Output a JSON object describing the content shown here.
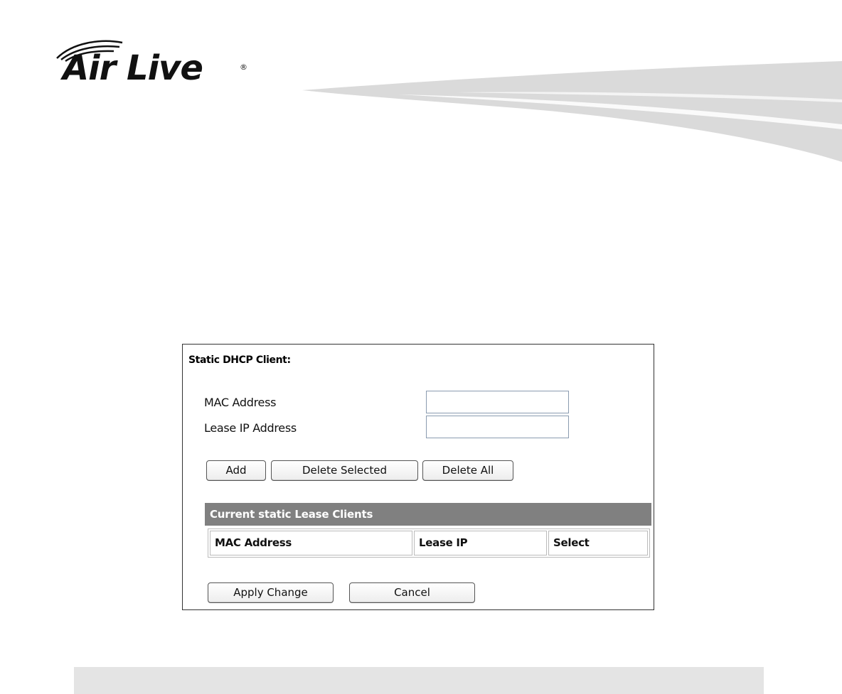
{
  "brand": {
    "logo_text": "Air Live",
    "registered_mark": "®"
  },
  "static_dhcp": {
    "title": "Static DHCP Client:",
    "mac_label": "MAC Address",
    "mac_value": "",
    "lease_ip_label": "Lease IP Address",
    "lease_ip_value": "",
    "buttons": {
      "add": "Add",
      "delete_selected": "Delete Selected",
      "delete_all": "Delete All",
      "apply": "Apply Change",
      "cancel": "Cancel"
    },
    "table": {
      "title": "Current static Lease Clients",
      "columns": [
        "MAC Address",
        "Lease IP",
        "Select"
      ],
      "rows": []
    }
  },
  "colors": {
    "table_header_bg": "#808080",
    "swoosh": "#d9d9d9",
    "footer_bar": "#e4e4e4"
  },
  "icons": {
    "logo_waves": "wifi-waves-icon"
  }
}
